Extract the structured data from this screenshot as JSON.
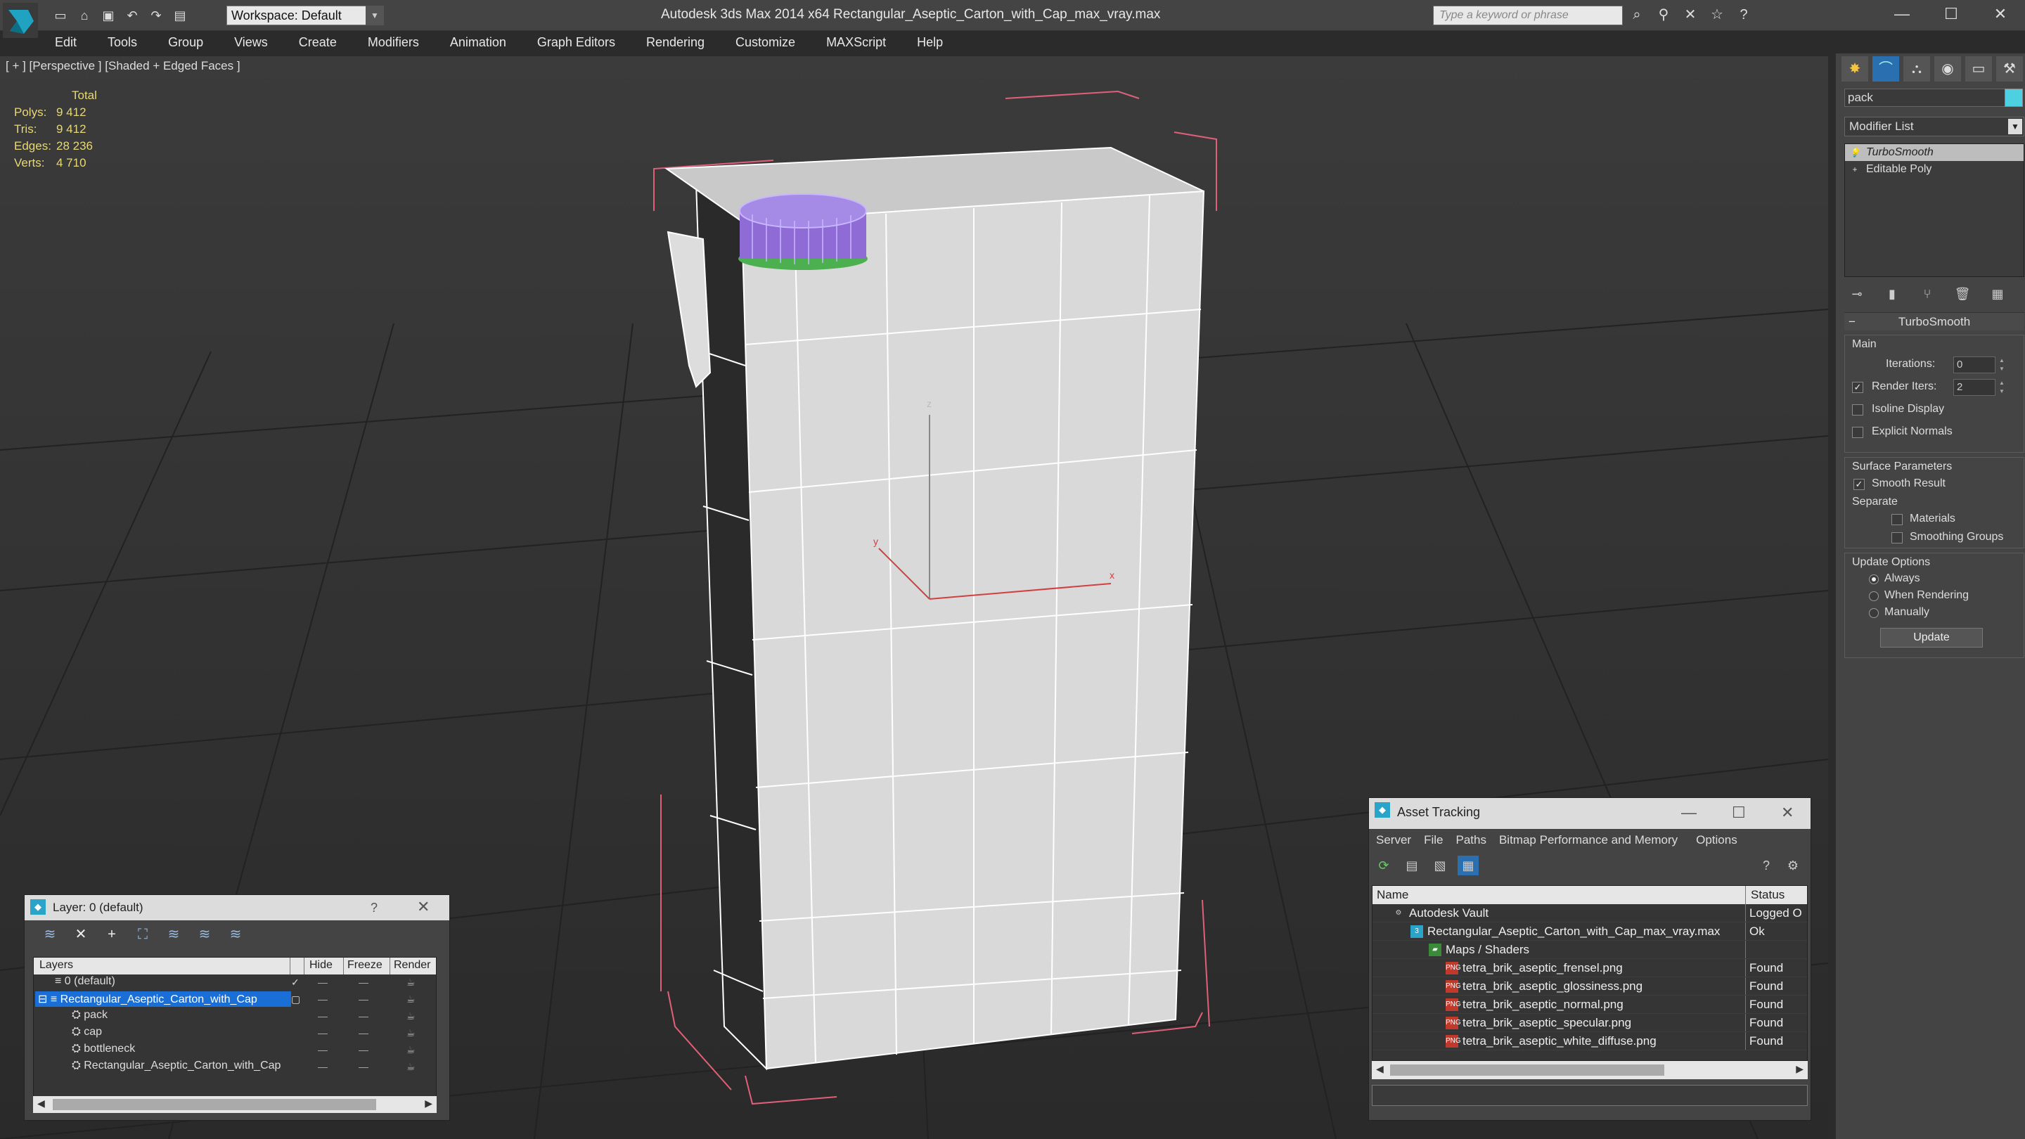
{
  "app": {
    "title": "Autodesk 3ds Max  2014 x64      Rectangular_Aseptic_Carton_with_Cap_max_vray.max",
    "workspace_label": "Workspace: Default",
    "search_placeholder": "Type a keyword or phrase"
  },
  "menu": [
    "Edit",
    "Tools",
    "Group",
    "Views",
    "Create",
    "Modifiers",
    "Animation",
    "Graph Editors",
    "Rendering",
    "Customize",
    "MAXScript",
    "Help"
  ],
  "viewport": {
    "label": "[ + ] [Perspective ] [Shaded + Edged Faces ]",
    "stats": {
      "header": "Total",
      "rows": [
        {
          "label": "Polys:",
          "value": "9 412"
        },
        {
          "label": "Tris:",
          "value": "9 412"
        },
        {
          "label": "Edges:",
          "value": "28 236"
        },
        {
          "label": "Verts:",
          "value": "4 710"
        }
      ]
    },
    "axis": {
      "x": "x",
      "y": "y",
      "z": "z"
    }
  },
  "command_panel": {
    "object_name": "pack",
    "object_color": "#4dd0e1",
    "modifier_list_label": "Modifier List",
    "stack": [
      {
        "label": "TurboSmooth",
        "selected": true
      },
      {
        "label": "Editable Poly",
        "selected": false
      }
    ],
    "turbosmooth": {
      "title": "TurboSmooth",
      "main_label": "Main",
      "iterations_label": "Iterations:",
      "iterations_value": "0",
      "render_iters_label": "Render Iters:",
      "render_iters_value": "2",
      "isoline_label": "Isoline Display",
      "explicit_normals_label": "Explicit Normals",
      "surface_params_label": "Surface Parameters",
      "smooth_result_label": "Smooth Result",
      "separate_label": "Separate",
      "materials_label": "Materials",
      "smoothing_groups_label": "Smoothing Groups",
      "update_options_label": "Update Options",
      "always_label": "Always",
      "when_rendering_label": "When Rendering",
      "manually_label": "Manually",
      "update_button": "Update"
    }
  },
  "layer_dialog": {
    "title": "Layer: 0 (default)",
    "help": "?",
    "columns": {
      "layers": "Layers",
      "hide": "Hide",
      "freeze": "Freeze",
      "render": "Render"
    },
    "rows": [
      {
        "name": "0 (default)",
        "indent": 0,
        "selected": false
      },
      {
        "name": "Rectangular_Aseptic_Carton_with_Cap",
        "indent": 0,
        "selected": true
      },
      {
        "name": "pack",
        "indent": 1,
        "selected": false
      },
      {
        "name": "cap",
        "indent": 1,
        "selected": false
      },
      {
        "name": "bottleneck",
        "indent": 1,
        "selected": false
      },
      {
        "name": "Rectangular_Aseptic_Carton_with_Cap",
        "indent": 1,
        "selected": false
      }
    ]
  },
  "asset_dialog": {
    "title": "Asset Tracking",
    "menu": [
      "Server",
      "File",
      "Paths",
      "Bitmap Performance and Memory",
      "Options"
    ],
    "columns": {
      "name": "Name",
      "status": "Status"
    },
    "rows": [
      {
        "name": "Autodesk Vault",
        "status": "Logged O",
        "indent": 0,
        "icon": "vault-icon"
      },
      {
        "name": "Rectangular_Aseptic_Carton_with_Cap_max_vray.max",
        "status": "Ok",
        "indent": 1,
        "icon": "max-file-icon"
      },
      {
        "name": "Maps / Shaders",
        "status": "",
        "indent": 2,
        "icon": "maps-folder-icon"
      },
      {
        "name": "tetra_brik_aseptic_frensel.png",
        "status": "Found",
        "indent": 3,
        "icon": "png-file-icon"
      },
      {
        "name": "tetra_brik_aseptic_glossiness.png",
        "status": "Found",
        "indent": 3,
        "icon": "png-file-icon"
      },
      {
        "name": "tetra_brik_aseptic_normal.png",
        "status": "Found",
        "indent": 3,
        "icon": "png-file-icon"
      },
      {
        "name": "tetra_brik_aseptic_specular.png",
        "status": "Found",
        "indent": 3,
        "icon": "png-file-icon"
      },
      {
        "name": "tetra_brik_aseptic_white_diffuse.png",
        "status": "Found",
        "indent": 3,
        "icon": "png-file-icon"
      }
    ]
  }
}
